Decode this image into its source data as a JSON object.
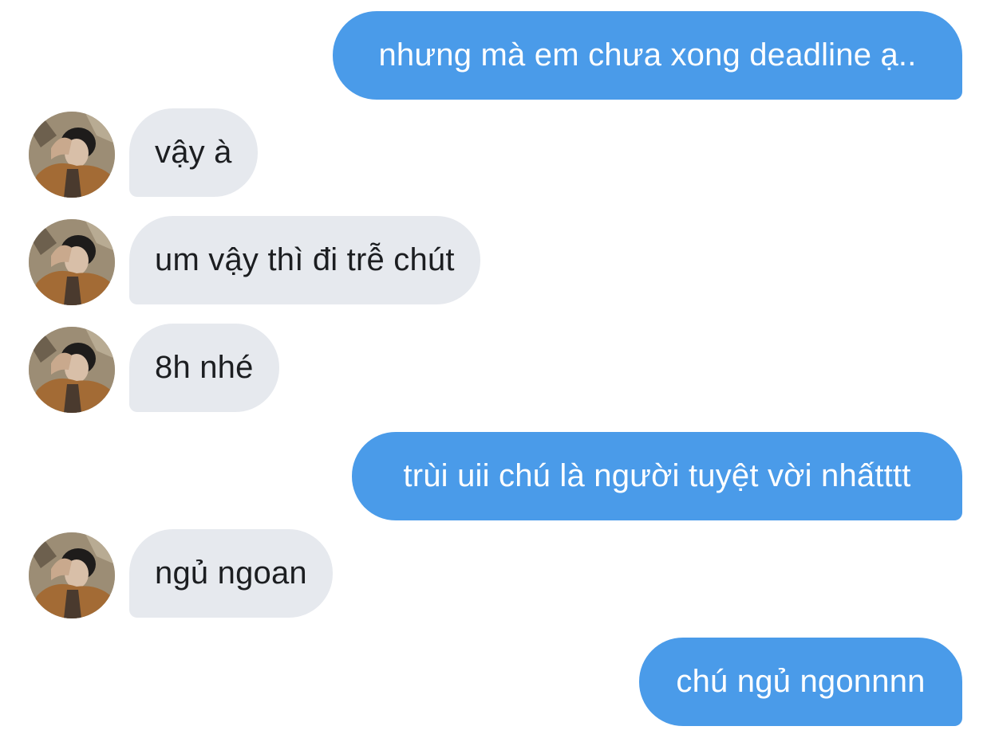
{
  "conversation": {
    "messages": [
      {
        "side": "sent",
        "text": "nhưng mà em chưa xong deadline ạ.."
      },
      {
        "side": "received",
        "text": "vậy à"
      },
      {
        "side": "received",
        "text": "um vậy thì đi trễ chút"
      },
      {
        "side": "received",
        "text": "8h nhé"
      },
      {
        "side": "sent",
        "text": "trùi uii chú là người tuyệt vời nhấtttt"
      },
      {
        "side": "received",
        "text": "ngủ ngoan"
      },
      {
        "side": "sent",
        "text": "chú ngủ ngonnnn"
      }
    ],
    "colors": {
      "sent_bubble": "#4a9be9",
      "received_bubble": "#e6e9ee",
      "sent_text": "#ffffff",
      "received_text": "#1c1e21"
    }
  }
}
